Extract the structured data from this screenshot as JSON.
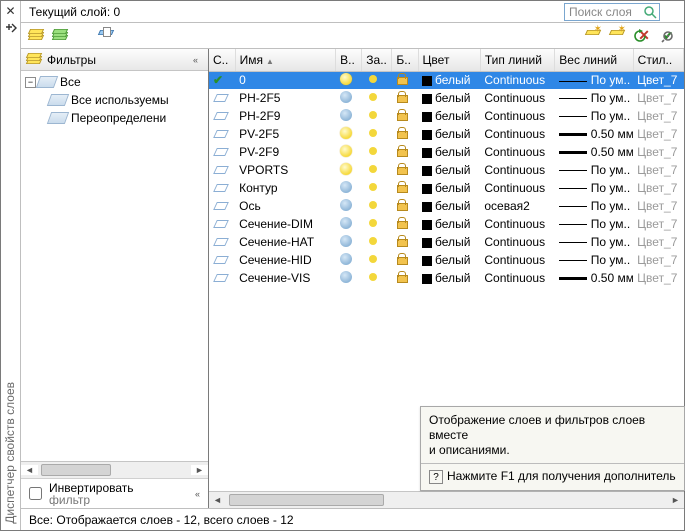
{
  "window": {
    "vertical_title": "Диспетчер свойств слоев",
    "current_layer_label": "Текущий слой: 0",
    "search_placeholder": "Поиск слоя"
  },
  "filters_panel": {
    "header": "Фильтры",
    "root": "Все",
    "children": [
      "Все используемы",
      "Переопределени"
    ],
    "invert_label1": "Инвертировать",
    "invert_label2": "фильтр"
  },
  "columns": {
    "status": "С..",
    "name": "Имя",
    "on": "В..",
    "freeze": "За..",
    "lock": "Б..",
    "color": "Цвет",
    "linetype": "Тип линий",
    "lineweight": "Вес линий",
    "style": "Стил.."
  },
  "layers": [
    {
      "name": "0",
      "on": true,
      "freeze": false,
      "color": "белый",
      "linetype": "Continuous",
      "weight": "По ум..",
      "w": "thin",
      "style": "Цвет_7",
      "current": true,
      "sel": true
    },
    {
      "name": "PH-2F5",
      "on": false,
      "freeze": false,
      "color": "белый",
      "linetype": "Continuous",
      "weight": "По ум..",
      "w": "thin",
      "style": "Цвет_7"
    },
    {
      "name": "PH-2F9",
      "on": false,
      "freeze": false,
      "color": "белый",
      "linetype": "Continuous",
      "weight": "По ум..",
      "w": "thin",
      "style": "Цвет_7"
    },
    {
      "name": "PV-2F5",
      "on": true,
      "freeze": false,
      "color": "белый",
      "linetype": "Continuous",
      "weight": "0.50 мм",
      "w": "med",
      "style": "Цвет_7"
    },
    {
      "name": "PV-2F9",
      "on": true,
      "freeze": false,
      "color": "белый",
      "linetype": "Continuous",
      "weight": "0.50 мм",
      "w": "med",
      "style": "Цвет_7"
    },
    {
      "name": "VPORTS",
      "on": true,
      "freeze": false,
      "color": "белый",
      "linetype": "Continuous",
      "weight": "По ум..",
      "w": "thin",
      "style": "Цвет_7"
    },
    {
      "name": "Контур",
      "on": false,
      "freeze": false,
      "color": "белый",
      "linetype": "Continuous",
      "weight": "По ум..",
      "w": "thin",
      "style": "Цвет_7"
    },
    {
      "name": "Ось",
      "on": false,
      "freeze": false,
      "color": "белый",
      "linetype": "осевая2",
      "weight": "По ум..",
      "w": "thin",
      "style": "Цвет_7"
    },
    {
      "name": "Сечение-DIM",
      "on": false,
      "freeze": false,
      "color": "белый",
      "linetype": "Continuous",
      "weight": "По ум..",
      "w": "thin",
      "style": "Цвет_7"
    },
    {
      "name": "Сечение-HAT",
      "on": false,
      "freeze": false,
      "color": "белый",
      "linetype": "Continuous",
      "weight": "По ум..",
      "w": "thin",
      "style": "Цвет_7"
    },
    {
      "name": "Сечение-HID",
      "on": false,
      "freeze": false,
      "color": "белый",
      "linetype": "Continuous",
      "weight": "По ум..",
      "w": "thin",
      "style": "Цвет_7"
    },
    {
      "name": "Сечение-VIS",
      "on": false,
      "freeze": false,
      "color": "белый",
      "linetype": "Continuous",
      "weight": "0.50 мм",
      "w": "med",
      "style": "Цвет_7"
    }
  ],
  "tooltip": {
    "line1": "Отображение слоев и фильтров слоев вместе",
    "line2": "и описаниями.",
    "help": "Нажмите F1 для получения дополнитель"
  },
  "status": "Все: Отображается слоев - 12, всего слоев - 12"
}
